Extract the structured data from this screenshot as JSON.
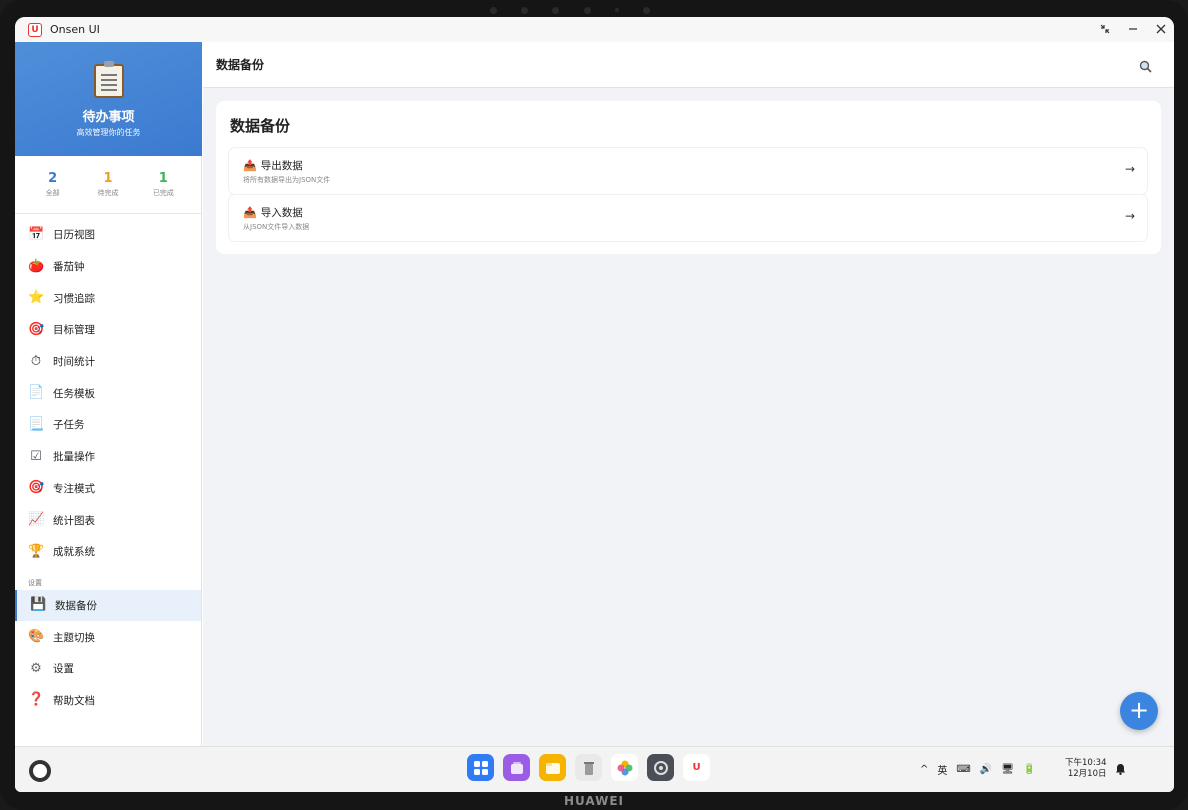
{
  "window": {
    "title": "Onsen UI",
    "logo_text": "U"
  },
  "sidebar": {
    "title": "待办事项",
    "subtitle": "高效管理你的任务",
    "stats": [
      {
        "value": "2",
        "label": "全部",
        "color": "#3b7ad0"
      },
      {
        "value": "1",
        "label": "待完成",
        "color": "#f0a020"
      },
      {
        "value": "1",
        "label": "已完成",
        "color": "#3bb55a"
      }
    ],
    "items": [
      {
        "label": "日历视图",
        "icon": "calendar-icon",
        "glyph": "📅"
      },
      {
        "label": "番茄钟",
        "icon": "tomato-icon",
        "glyph": "🍅"
      },
      {
        "label": "习惯追踪",
        "icon": "star-icon",
        "glyph": "⭐"
      },
      {
        "label": "目标管理",
        "icon": "target-icon",
        "glyph": "🎯"
      },
      {
        "label": "时间统计",
        "icon": "stopwatch-icon",
        "glyph": "⏱"
      },
      {
        "label": "任务模板",
        "icon": "document-icon",
        "glyph": "📄"
      },
      {
        "label": "子任务",
        "icon": "page-icon",
        "glyph": "📃"
      },
      {
        "label": "批量操作",
        "icon": "checkbox-icon",
        "glyph": "☑"
      },
      {
        "label": "专注模式",
        "icon": "target-icon",
        "glyph": "🎯"
      },
      {
        "label": "统计图表",
        "icon": "chart-icon",
        "glyph": "📈"
      },
      {
        "label": "成就系统",
        "icon": "trophy-icon",
        "glyph": "🏆"
      }
    ],
    "settings_section_label": "设置",
    "settings_items": [
      {
        "label": "数据备份",
        "icon": "floppy-disk-icon",
        "glyph": "💾",
        "active": true
      },
      {
        "label": "主题切换",
        "icon": "palette-icon",
        "glyph": "🎨"
      },
      {
        "label": "设置",
        "icon": "gear-icon",
        "glyph": "⚙"
      },
      {
        "label": "帮助文档",
        "icon": "question-icon",
        "glyph": "❓"
      }
    ]
  },
  "main": {
    "topbar_title": "数据备份",
    "card_title": "数据备份",
    "rows": [
      {
        "title": "导出数据",
        "subtitle": "将所有数据导出为JSON文件",
        "icon": "export-tray-icon",
        "glyph": "📤",
        "arrow": "→"
      },
      {
        "title": "导入数据",
        "subtitle": "从JSON文件导入数据",
        "icon": "import-tray-icon",
        "glyph": "📤",
        "arrow": "→"
      }
    ],
    "fab_label": "+"
  },
  "taskbar": {
    "tray_items": [
      "^",
      "英",
      "⌨",
      "🔊",
      "🖥",
      "🔋"
    ],
    "time": "下午10:34",
    "date": "12月10日"
  },
  "device_brand": "HUAWEI"
}
